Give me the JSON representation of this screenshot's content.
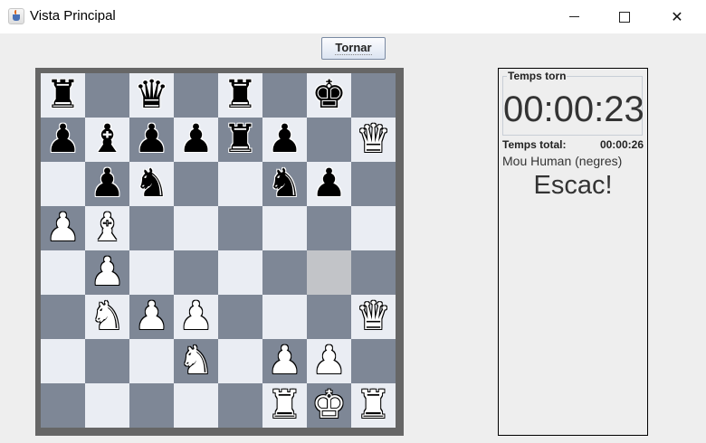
{
  "window": {
    "title": "Vista Principal",
    "icon": "java-cup-icon"
  },
  "toolbar": {
    "back_label": "Tornar"
  },
  "board": {
    "light_color": "#eaedf3",
    "dark_color": "#7e8796",
    "highlight_color": "#c2c4c8",
    "highlighted_square": "g4",
    "rows": [
      [
        "bR",
        "",
        "bQ",
        "",
        "bR",
        "",
        "bK",
        ""
      ],
      [
        "bP",
        "bB",
        "bP",
        "bP",
        "bR",
        "bP",
        "",
        "wQ"
      ],
      [
        "",
        "bP",
        "bN",
        "",
        "",
        "bN",
        "bP",
        ""
      ],
      [
        "wP",
        "wB",
        "",
        "",
        "",
        "",
        "",
        ""
      ],
      [
        "",
        "wP",
        "",
        "",
        "",
        "",
        "",
        ""
      ],
      [
        "",
        "wN",
        "wP",
        "wP",
        "",
        "",
        "",
        "wQ"
      ],
      [
        "",
        "",
        "",
        "wN",
        "",
        "wP",
        "wP",
        ""
      ],
      [
        "",
        "",
        "",
        "",
        "",
        "wR",
        "wK",
        "wR"
      ]
    ],
    "glyphs": {
      "K": "♚",
      "Q": "♛",
      "R": "♜",
      "B": "♝",
      "N": "♞",
      "P": "♟"
    }
  },
  "panel": {
    "turn_time_title": "Temps torn",
    "turn_time": "00:00:23",
    "total_time_label": "Temps total:",
    "total_time": "00:00:26",
    "move_text": "Mou Human (negres)",
    "status": "Escac!"
  }
}
